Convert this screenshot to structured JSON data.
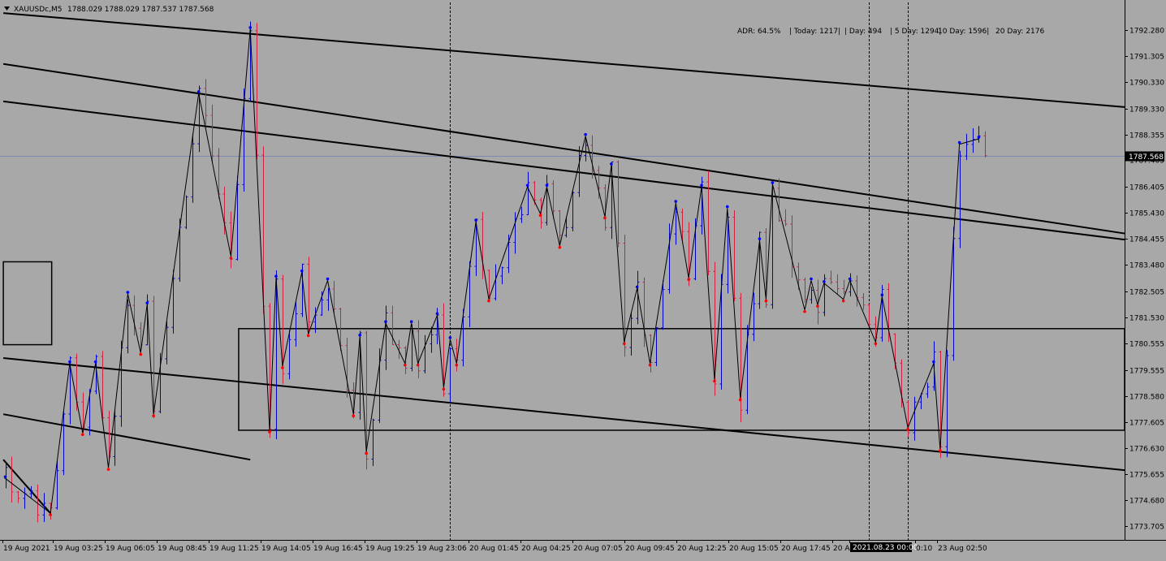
{
  "header": {
    "menu_icon": "triangle-down-icon",
    "symbol": "XAUUSDc,M5",
    "ohlc": "1788.029 1788.029 1787.537 1787.568"
  },
  "adr_panel": {
    "items": [
      "ADR: 64.5%",
      "| Today: 1217|",
      "| Day: 494",
      "| 5 Day: 1294|",
      "10 Day: 1596|",
      "20 Day: 2176"
    ]
  },
  "colors": {
    "background": "#a8a8a8",
    "bull_bar": "#0000cc",
    "bear_bar": "#d02040",
    "grid_line": "#000000",
    "price_line": "#7a8ab0",
    "price_label_bg": "#000000",
    "price_label_fg": "#ffffff",
    "crosshair_label_bg": "#000000"
  },
  "chart_data": {
    "type": "candlestick",
    "title": "",
    "xlabel": "",
    "ylabel": "",
    "ylim": [
      1773.2,
      1793.3
    ],
    "y_ticks": [
      "1792.280",
      "1791.305",
      "1790.330",
      "1789.330",
      "1788.355",
      "1787.405",
      "1786.405",
      "1785.430",
      "1784.455",
      "1783.480",
      "1782.505",
      "1781.530",
      "1780.555",
      "1779.555",
      "1778.580",
      "1777.605",
      "1776.630",
      "1775.655",
      "1774.680",
      "1773.705"
    ],
    "x_ticks": [
      "19 Aug 2021",
      "19 Aug 03:25",
      "19 Aug 06:05",
      "19 Aug 08:45",
      "19 Aug 11:25",
      "19 Aug 14:05",
      "19 Aug 16:45",
      "19 Aug 19:25",
      "19 Aug 23:06",
      "20 Aug 01:45",
      "20 Aug 04:25",
      "20 Aug 07:05",
      "20 Aug 09:45",
      "20 Aug 12:25",
      "20 Aug 15:05",
      "20 Aug 17:45",
      "20 A",
      "2021.08.23 00:00",
      "0:10",
      "23 Aug 02:50"
    ],
    "current_price": "1787.568",
    "current_price_value": 1787.568,
    "crosshair_label": "2021.08.23 00:00",
    "zigzag": [
      [
        0,
        1775.5
      ],
      [
        7,
        1774.2
      ],
      [
        10,
        1779.8
      ],
      [
        12,
        1777.2
      ],
      [
        14,
        1779.8
      ],
      [
        16,
        1775.9
      ],
      [
        19,
        1782.4
      ],
      [
        21,
        1780.2
      ],
      [
        22,
        1782.0
      ],
      [
        23,
        1777.9
      ],
      [
        30,
        1789.9
      ],
      [
        35,
        1783.8
      ],
      [
        38,
        1792.3
      ],
      [
        41,
        1777.3
      ],
      [
        42,
        1783.0
      ],
      [
        43,
        1779.7
      ],
      [
        46,
        1783.2
      ],
      [
        47,
        1780.9
      ],
      [
        50,
        1782.9
      ],
      [
        54,
        1777.9
      ],
      [
        55,
        1780.8
      ],
      [
        56,
        1776.5
      ],
      [
        59,
        1781.3
      ],
      [
        62,
        1779.8
      ],
      [
        63,
        1781.3
      ],
      [
        64,
        1779.8
      ],
      [
        67,
        1781.6
      ],
      [
        68,
        1778.9
      ],
      [
        69,
        1780.7
      ],
      [
        70,
        1779.8
      ],
      [
        73,
        1785.1
      ],
      [
        75,
        1782.2
      ],
      [
        81,
        1786.4
      ],
      [
        83,
        1785.4
      ],
      [
        84,
        1786.4
      ],
      [
        86,
        1784.2
      ],
      [
        90,
        1788.3
      ],
      [
        93,
        1785.3
      ],
      [
        94,
        1787.2
      ],
      [
        96,
        1780.6
      ],
      [
        98,
        1782.6
      ],
      [
        100,
        1779.8
      ],
      [
        104,
        1785.8
      ],
      [
        106,
        1783.0
      ],
      [
        108,
        1786.4
      ],
      [
        110,
        1779.2
      ],
      [
        112,
        1785.6
      ],
      [
        114,
        1778.5
      ],
      [
        117,
        1784.4
      ],
      [
        118,
        1782.2
      ],
      [
        119,
        1786.5
      ],
      [
        124,
        1781.8
      ],
      [
        125,
        1782.9
      ],
      [
        126,
        1782.0
      ],
      [
        127,
        1782.8
      ],
      [
        130,
        1782.2
      ],
      [
        131,
        1782.9
      ],
      [
        135,
        1780.6
      ],
      [
        136,
        1782.3
      ],
      [
        140,
        1777.4
      ],
      [
        144,
        1779.8
      ],
      [
        145,
        1776.6
      ],
      [
        148,
        1788.0
      ],
      [
        151,
        1788.2
      ]
    ],
    "last_bar_index": 152,
    "bar_count": 153,
    "trendlines": [
      {
        "p1": [
          -0.3,
          1792.9
        ],
        "p2": [
          178,
          1789.3
        ]
      },
      {
        "p1": [
          -0.3,
          1791.0
        ],
        "p2": [
          178,
          1784.5
        ]
      },
      {
        "p1": [
          -0.3,
          1789.6
        ],
        "p2": [
          178,
          1784.3
        ]
      },
      {
        "p1": [
          -0.3,
          1780.0
        ],
        "p2": [
          178,
          1775.7
        ]
      },
      {
        "p1": [
          -0.3,
          1777.9
        ],
        "p2": [
          38,
          1776.2
        ]
      },
      {
        "p1": [
          -0.3,
          1776.2
        ],
        "p2": [
          7,
          1774.2
        ]
      }
    ],
    "rectangles": [
      {
        "x1": -0.3,
        "x2": 7.2,
        "y1": 1780.5,
        "y2": 1783.6
      },
      {
        "x1": 36.2,
        "x2": 178,
        "y1": 1777.3,
        "y2": 1781.1
      }
    ],
    "vertical_lines": [
      69,
      134,
      140
    ]
  }
}
